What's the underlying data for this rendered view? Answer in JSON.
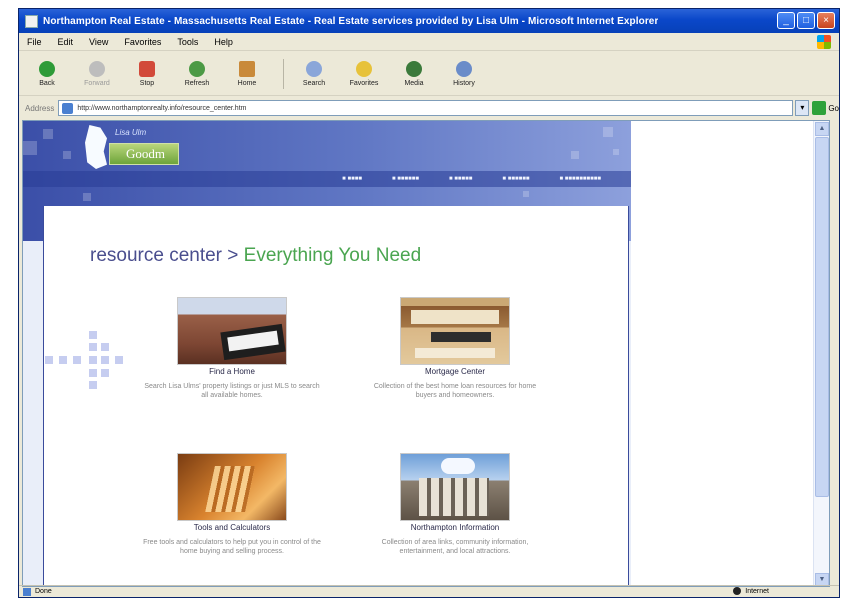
{
  "window": {
    "title": "Northampton Real Estate - Massachusetts Real Estate - Real Estate services provided by Lisa Ulm - Microsoft Internet Explorer",
    "controls": [
      "minimize",
      "maximize",
      "close"
    ]
  },
  "menu": [
    "File",
    "Edit",
    "View",
    "Favorites",
    "Tools",
    "Help"
  ],
  "toolbar": {
    "back": "Back",
    "forward": "Forward",
    "stop": "Stop",
    "refresh": "Refresh",
    "home": "Home",
    "search": "Search",
    "favorites": "Favorites",
    "media": "Media",
    "history": "History"
  },
  "address": {
    "label": "Address",
    "url": "http://www.northamptonrealty.info/resource_center.htm",
    "go": "Go"
  },
  "site": {
    "logo_top": "Lisa Ulm",
    "logo_main": "Goodm",
    "title_prefix": "resource center > ",
    "title_suffix": "Everything You Need",
    "cards": [
      {
        "label": "Find a Home",
        "desc": "Search Lisa Ulms' property listings or just MLS to search all available homes."
      },
      {
        "label": "Mortgage Center",
        "desc": "Collection of the best home loan resources for home buyers and homeowners."
      },
      {
        "label": "Tools and Calculators",
        "desc": "Free tools and calculators to help put you in control of the home buying and selling process."
      },
      {
        "label": "Northampton Information",
        "desc": "Collection of area links, community information, entertainment, and local attractions."
      }
    ]
  },
  "status": {
    "left": "Done",
    "zone": "Internet"
  },
  "colors": {
    "title_left": "#4a4e8e",
    "title_right": "#4aa550",
    "banner": "#364aa0"
  }
}
